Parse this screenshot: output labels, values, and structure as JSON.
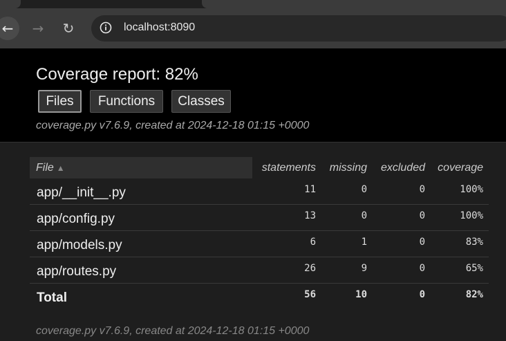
{
  "browser": {
    "url": "localhost:8090",
    "back_icon": "←",
    "forward_icon": "→",
    "reload_icon": "↻"
  },
  "report": {
    "title": "Coverage report: 82%",
    "tabs": [
      "Files",
      "Functions",
      "Classes"
    ],
    "meta": "coverage.py v7.6.9, created at 2024-12-18 01:15 +0000",
    "footer": "coverage.py v7.6.9, created at 2024-12-18 01:15 +0000"
  },
  "table": {
    "columns": [
      "File",
      "statements",
      "missing",
      "excluded",
      "coverage"
    ],
    "sort_indicator": "▲",
    "rows": [
      {
        "file": "app/__init__.py",
        "statements": "11",
        "missing": "0",
        "excluded": "0",
        "coverage": "100%"
      },
      {
        "file": "app/config.py",
        "statements": "13",
        "missing": "0",
        "excluded": "0",
        "coverage": "100%"
      },
      {
        "file": "app/models.py",
        "statements": "6",
        "missing": "1",
        "excluded": "0",
        "coverage": "83%"
      },
      {
        "file": "app/routes.py",
        "statements": "26",
        "missing": "9",
        "excluded": "0",
        "coverage": "65%"
      }
    ],
    "total": {
      "file": "Total",
      "statements": "56",
      "missing": "10",
      "excluded": "0",
      "coverage": "82%"
    }
  }
}
